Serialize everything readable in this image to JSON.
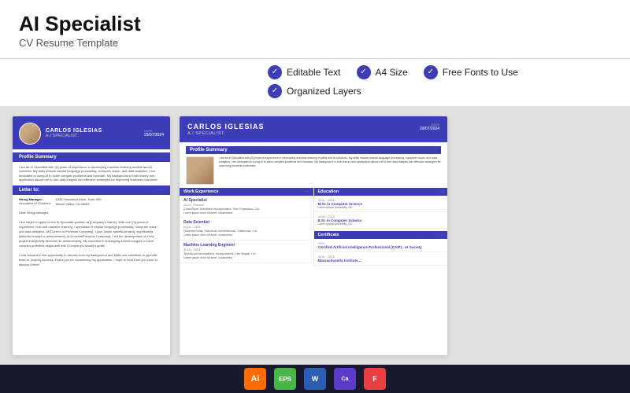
{
  "header": {
    "title": "AI Specialist",
    "subtitle": "CV Resume Template"
  },
  "features": [
    {
      "id": "editable-text",
      "label": "Editable Text"
    },
    {
      "id": "a4-size",
      "label": "A4 Size"
    },
    {
      "id": "free-fonts",
      "label": "Free Fonts to Use"
    },
    {
      "id": "organized-layers",
      "label": "Organized Layers"
    }
  ],
  "cv_left": {
    "name": "CARLOS IGLESIAS",
    "role": "A.I SPECIALIST",
    "date_label": "DATE",
    "date_value": "29/07/2024",
    "profile_summary_title": "Profile Summary",
    "profile_text": "I am an AI Specialist with [X] years of experience in developing machine learning models and AI solutions. My skills include natural language processing, computer vision, and data analytics. I am dedicated to using AI to solve complex problems and innovate. My background in both theory and application allows me to turn data insights into effective strategies for improving business outcomes.",
    "letter_title": "Letter to:",
    "recipient_name": "Hiring Manager",
    "company": "Innovative AI Solutions",
    "address": "1234 Innovation Drive, Suite 500\nSilicon Valley, CA 98003",
    "letter_body": "Dear Hiring Manager,\n\nI am eager to apply for the AI Specialist position at [Company's Name]. With over [X] years of experience in AI and machine learning, I specialize in natural language processing, computer vision, and data analytics. At [Current or Previous Company], I your [insert specific project], significantly [describe impact or achievement]. At [Current/Previous Company], I led the development of a key project that [briefly describe an achievement]. My expertise in leveraging AI technologies to solve complex problems aligns well with [Company's Name]'s goals.\n\nI look forward to the opportunity to discuss how my background and skills can contribute to [specific team or project] success. Thank you for considering my application. I hope to hear from you soon to discuss further."
  },
  "cv_right": {
    "name": "CARLOS IGLESIAS",
    "role": "A.I SPECIALIST",
    "date_label": "DATE",
    "date_value": "29/07/2024",
    "profile_summary_title": "Profile Summary",
    "profile_text": "I am an AI Specialist with [X] years of experience in developing machine learning models and AI solutions. My skills include natural language processing, computer vision, and data analytics. I am dedicated to using AI to solve complex problems and innovate. My background in both theory and application allows me to turn data insights into effective strategies for improving business outcomes.",
    "work_experience_title": "Work Experience",
    "education_title": "Education",
    "certificate_title": "Certificate",
    "jobs": [
      {
        "title": "AI Specialist",
        "company": "CloudSync Solutions Incorporated, San Francisco, CA",
        "dates": "2023 - Present",
        "text": "Lorem ipsum dolor sit amet, consectetur"
      },
      {
        "title": "Data Scientist",
        "company": "QuantumLeap Solutions International, California, CA",
        "dates": "2018 - 2023",
        "text": "Lorem ipsum dolor sit amet, consectetur"
      },
      {
        "title": "Machine Learning Engineer",
        "company": "TechNova Innovations Incorporated, Las Vegas, CA",
        "dates": "2015 - 2023",
        "text": "Lorem ipsum dolor sit amet, consectetur"
      }
    ],
    "education": [
      {
        "dates": "2015 - 2018",
        "degree": "M.Sc in Computer Science",
        "school": "Lorem Ipsum University, CA"
      },
      {
        "dates": "2015 - 2018",
        "degree": "B.Sc in Computer Science",
        "school": "Lorem Ipsum University, CA"
      }
    ],
    "certificates": [
      {
        "year": "2022",
        "name": "Certified Artificial Intelligence Professional (CAIP) - AI Society"
      },
      {
        "dates": "2015 - 2018",
        "name": "Massachusetts Institute..."
      }
    ]
  },
  "toolbar": {
    "tools": [
      {
        "id": "ai",
        "label": "Ai"
      },
      {
        "id": "eps",
        "label": "EPS"
      },
      {
        "id": "word",
        "label": "W"
      },
      {
        "id": "canva",
        "label": "Ca"
      },
      {
        "id": "figma",
        "label": "F"
      }
    ]
  }
}
